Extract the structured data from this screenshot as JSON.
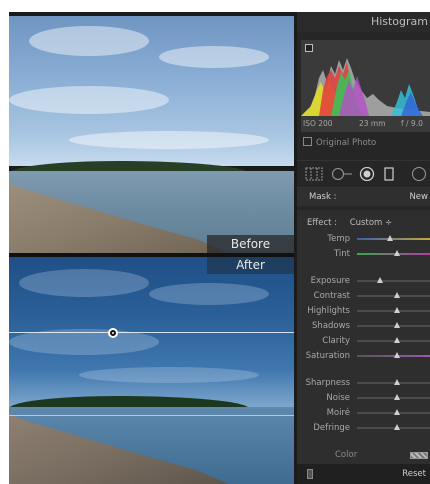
{
  "photo": {
    "before_label": "Before",
    "after_label": "After"
  },
  "panel": {
    "title": "Histogram",
    "exif": {
      "iso": "ISO 200",
      "focal": "23 mm",
      "aperture": "f / 9.0"
    },
    "original_photo_label": "Original Photo",
    "mask": {
      "label": "Mask :",
      "value": "New"
    },
    "effect": {
      "label": "Effect :",
      "preset": "Custom ÷"
    },
    "sliders": [
      {
        "label": "Temp",
        "value": 0.45
      },
      {
        "label": "Tint",
        "value": 0.55
      },
      {
        "label": "Exposure",
        "value": 0.32
      },
      {
        "label": "Contrast",
        "value": 0.55
      },
      {
        "label": "Highlights",
        "value": 0.55
      },
      {
        "label": "Shadows",
        "value": 0.55
      },
      {
        "label": "Clarity",
        "value": 0.55
      },
      {
        "label": "Saturation",
        "value": 0.55
      },
      {
        "label": "Sharpness",
        "value": 0.55
      },
      {
        "label": "Noise",
        "value": 0.55
      },
      {
        "label": "Moiré",
        "value": 0.55
      },
      {
        "label": "Defringe",
        "value": 0.55
      }
    ],
    "color_label": "Color",
    "reset_label": "Reset"
  }
}
